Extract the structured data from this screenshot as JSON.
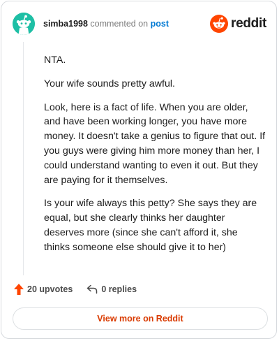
{
  "header": {
    "username": "simba1998",
    "commented_on_text": "commented on",
    "post_link": "post",
    "brand_name": "reddit"
  },
  "comment": {
    "paragraphs": [
      "NTA.",
      "Your wife sounds pretty awful.",
      "Look, here is a fact of life. When you are older, and have been working longer, you have more money. It doesn't take a genius to figure that out. If you guys were giving him more money than her, I could understand wanting to even it out. But they are paying for it themselves.",
      "Is your wife always this petty? She says they are equal, but she clearly thinks her daughter deserves more (since she can't afford it, she thinks someone else should give it to her)"
    ]
  },
  "actions": {
    "upvotes": "20 upvotes",
    "replies": "0 replies"
  },
  "footer": {
    "view_more_label": "View more on Reddit"
  },
  "icons": {
    "avatar": "snoo-avatar-icon",
    "logo": "reddit-logo-icon",
    "upvote": "upvote-arrow-icon",
    "reply": "reply-arrow-icon"
  },
  "colors": {
    "accent": "#ff4500",
    "link": "#0079d3",
    "view_more": "#d93a00",
    "avatar_bg": "#1ebfa5"
  }
}
